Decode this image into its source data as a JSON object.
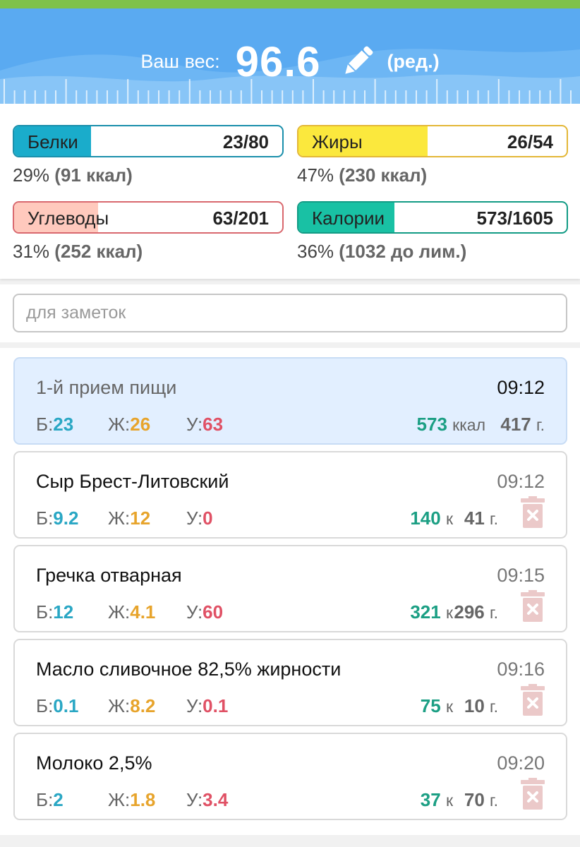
{
  "header": {
    "weight_label": "Ваш вес:",
    "weight_value": "96.6",
    "edit_label": "(ред.)",
    "background_color": "#5aaaf1",
    "strip_color": "#7fc24a"
  },
  "macros": {
    "protein": {
      "name": "Белки",
      "value": "23/80",
      "fraction": 0.288,
      "summary_pct": "29%",
      "summary_detail": "(91 ккал)",
      "color": "#1aaccb",
      "border": "#1a8fab"
    },
    "fat": {
      "name": "Жиры",
      "value": "26/54",
      "fraction": 0.481,
      "summary_pct": "47%",
      "summary_detail": "(230 ккал)",
      "color": "#fbe83d",
      "border": "#e3b737"
    },
    "carbs": {
      "name": "Углеводы",
      "value": "63/201",
      "fraction": 0.313,
      "summary_pct": "31%",
      "summary_detail": "(252 ккал)",
      "color": "#ffc9bd",
      "border": "#d9686e"
    },
    "calories": {
      "name": "Калории",
      "value": "573/1605",
      "fraction": 0.357,
      "summary_pct": "36%",
      "summary_detail": "(1032 до лим.)",
      "color": "#19c1a4",
      "border": "#129b85"
    }
  },
  "notes": {
    "placeholder": "для заметок",
    "value": ""
  },
  "labels": {
    "b": "Б:",
    "z": "Ж:",
    "u": "У:",
    "kcal_full": "ккал",
    "kcal_short": "к",
    "grams": "г."
  },
  "meal": {
    "title": "1-й прием пищи",
    "time": "09:12",
    "b": "23",
    "z": "26",
    "u": "63",
    "kcal": "573",
    "grams": "417"
  },
  "items": [
    {
      "title": "Сыр Брест-Литовский",
      "time": "09:12",
      "b": "9.2",
      "z": "12",
      "u": "0",
      "kcal": "140",
      "grams": "41"
    },
    {
      "title": "Гречка отварная",
      "time": "09:15",
      "b": "12",
      "z": "4.1",
      "u": "60",
      "kcal": "321",
      "grams": "296"
    },
    {
      "title": "Масло сливочное 82,5% жирности",
      "time": "09:16",
      "b": "0.1",
      "z": "8.2",
      "u": "0.1",
      "kcal": "75",
      "grams": "10"
    },
    {
      "title": "Молоко 2,5%",
      "time": "09:20",
      "b": "2",
      "z": "1.8",
      "u": "3.4",
      "kcal": "37",
      "grams": "70"
    }
  ]
}
